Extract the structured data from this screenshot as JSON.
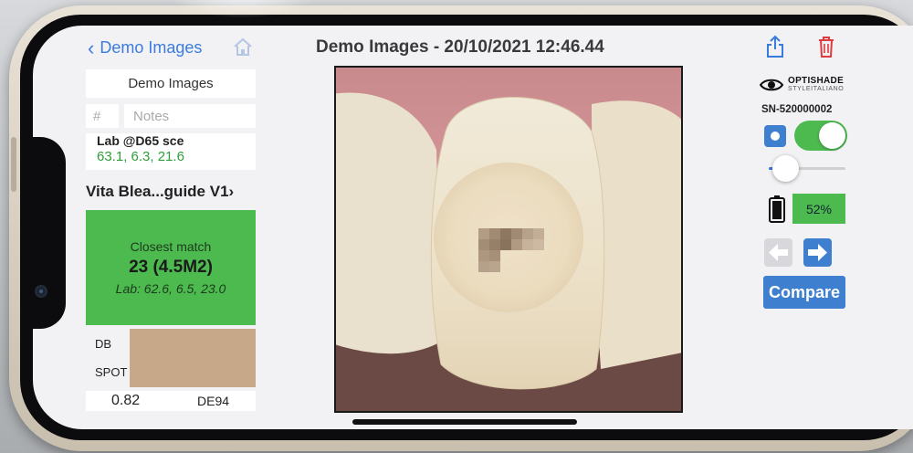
{
  "nav": {
    "back_label": "Demo Images",
    "title": "Demo Images - 20/10/2021 12:46.44",
    "icons": {
      "back": "chevron-left-icon",
      "home": "home-icon",
      "share": "share-icon",
      "delete": "trash-icon"
    }
  },
  "left_panel": {
    "database_name": "Demo Images",
    "number_placeholder": "#",
    "notes_placeholder": "Notes",
    "lab_label": "Lab @D65 sce",
    "lab_values": "63.1, 6.3, 21.6",
    "shade_guide": "Vita Blea...guide V1",
    "match": {
      "label": "Closest match",
      "value": "23 (4.5M2)",
      "lab": "Lab: 62.6, 6.5, 23.0"
    },
    "swatch_labels": {
      "db": "DB",
      "spot": "SPOT"
    },
    "delta_value": "0.82",
    "delta_label": "DE94"
  },
  "right_panel": {
    "logo_text": "OPTISHADE",
    "logo_subtext": "STYLEITALIANO",
    "serial_number": "SN-520000002",
    "toggle_on": true,
    "slider_value": 0.22,
    "battery_percent": "52%",
    "compare_label": "Compare"
  },
  "colors": {
    "accent_blue": "#3f7fcf",
    "link_blue": "#3b7be0",
    "success_green": "#4cba4f",
    "delete_red": "#e0393e",
    "swatch_tone": "#c7a98a"
  }
}
